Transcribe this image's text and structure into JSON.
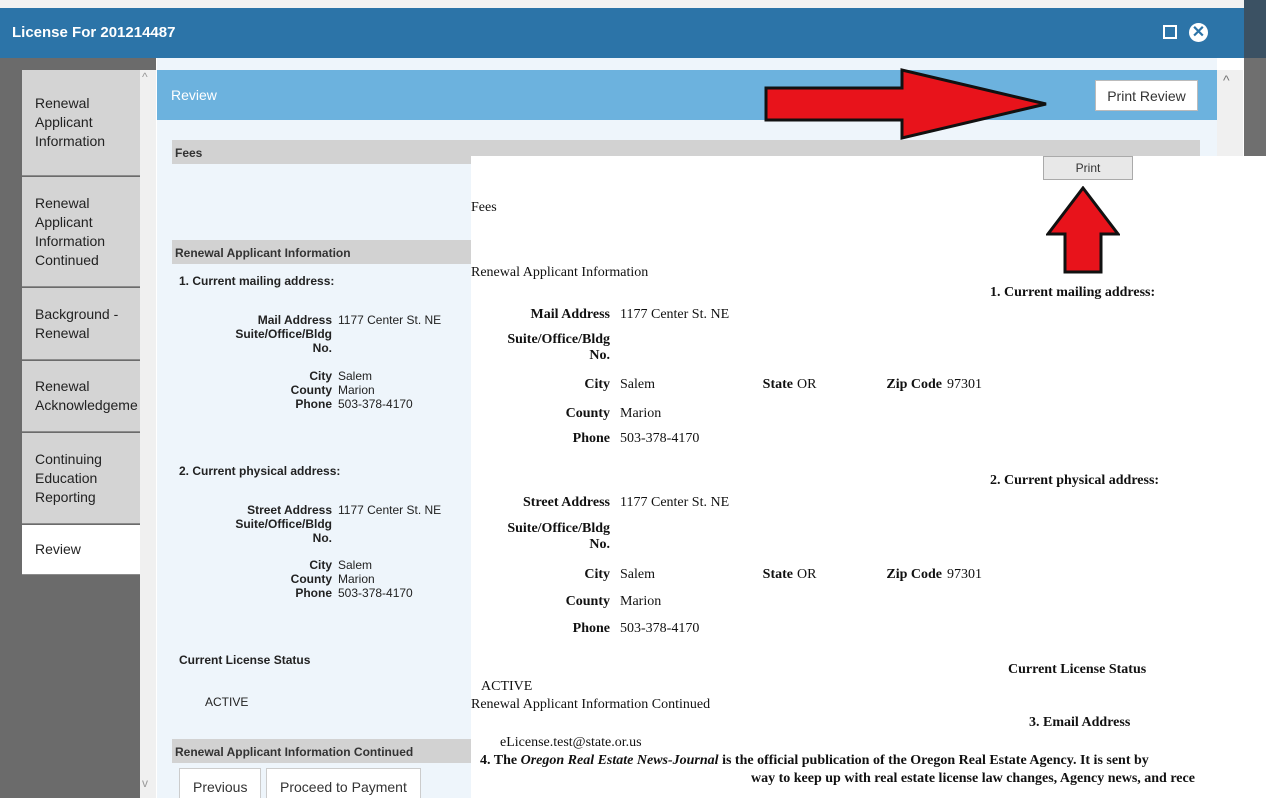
{
  "window": {
    "title": "License For 201214487"
  },
  "nav": {
    "items": [
      {
        "label": "Renewal\nApplicant\nInformation"
      },
      {
        "label": "Renewal\nApplicant\nInformation\nContinued"
      },
      {
        "label": "Background -\nRenewal"
      },
      {
        "label": "Renewal\nAcknowledgeme"
      },
      {
        "label": "Continuing\nEducation\nReporting"
      },
      {
        "label": "Review"
      }
    ]
  },
  "review": {
    "header": "Review",
    "print_review_label": "Print Review",
    "fees_label": "Fees",
    "section1_label": "Renewal Applicant Information",
    "mailing_heading": "1. Current mailing address:",
    "mailing": {
      "mail_address_label": "Mail Address",
      "mail_address": "1177 Center St. NE",
      "suite_label": "Suite/Office/Bldg\nNo.",
      "city_label": "City",
      "city": "Salem",
      "county_label": "County",
      "county": "Marion",
      "phone_label": "Phone",
      "phone": "503-378-4170"
    },
    "physical_heading": "2. Current physical address:",
    "physical": {
      "street_address_label": "Street Address",
      "street_address": "1177 Center St. NE",
      "suite_label": "Suite/Office/Bldg\nNo.",
      "city_label": "City",
      "city": "Salem",
      "county_label": "County",
      "county": "Marion",
      "phone_label": "Phone",
      "phone": "503-378-4170"
    },
    "status_heading": "Current License Status",
    "status_value": "ACTIVE",
    "section2_label": "Renewal Applicant Information Continued",
    "previous_label": "Previous",
    "proceed_label": "Proceed to Payment"
  },
  "print_preview": {
    "print_label": "Print",
    "fees": "Fees",
    "section1": "Renewal Applicant Information",
    "mailing_heading": "1. Current mailing address:",
    "mail_address_label": "Mail Address",
    "mail_address": "1177 Center St. NE",
    "suite_label_1": "Suite/Office/Bldg",
    "suite_label_2": "No.",
    "city_label": "City",
    "city": "Salem",
    "state_label": "State",
    "state": "OR",
    "zip_label": "Zip Code",
    "zip": "97301",
    "county_label": "County",
    "county": "Marion",
    "phone_label": "Phone",
    "phone": "503-378-4170",
    "physical_heading": "2. Current physical address:",
    "street_address_label": "Street Address",
    "street_address": "1177 Center St. NE",
    "status_heading": "Current License Status",
    "status_value": "ACTIVE",
    "section2": "Renewal Applicant Information Continued",
    "email_heading": "3. Email Address",
    "email": "eLicense.test@state.or.us",
    "q4_prefix": "4. The ",
    "q4_pub": "Oregon Real Estate News-Journal",
    "q4_rest": " is the official publication of the Oregon Real Estate Agency. It is sent by",
    "q4_line2": "way to keep up with real estate license law changes, Agency news, and rece"
  },
  "colors": {
    "titlebar": "#2c74a8",
    "review_header": "#6cb2de",
    "arrow": "#e8131b"
  }
}
